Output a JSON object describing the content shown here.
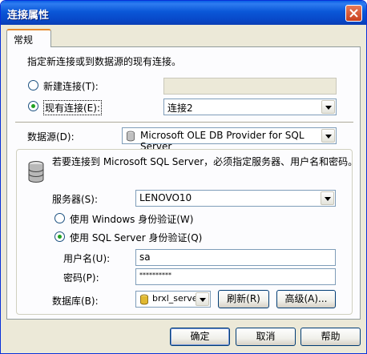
{
  "window": {
    "title": "连接属性"
  },
  "tabs": [
    {
      "label": "常规"
    }
  ],
  "general": {
    "instruction": "指定新连接或到数据源的现有连接。",
    "new_connection": {
      "label": "新建连接(T):",
      "value": ""
    },
    "existing_connection": {
      "label": "现有连接(E):",
      "value": "连接2"
    },
    "data_source": {
      "label": "数据源(D):",
      "value": "Microsoft OLE DB Provider for SQL Server"
    }
  },
  "sql_group": {
    "note": "若要连接到 Microsoft SQL Server，必须指定服务器、用户名和密码。",
    "server": {
      "label": "服务器(S):",
      "value": "LENOVO10"
    },
    "auth_windows": {
      "label": "使用 Windows 身份验证(W)"
    },
    "auth_sql": {
      "label": "使用 SQL Server 身份验证(Q)"
    },
    "username": {
      "label": "用户名(U):",
      "value": "sa"
    },
    "password": {
      "label": "密码(P):",
      "value": "**********"
    },
    "database": {
      "label": "数据库(B):",
      "value": "brxl_server"
    },
    "refresh_label": "刷新(R)",
    "advanced_label": "高级(A)..."
  },
  "footer": {
    "ok_label": "确定",
    "cancel_label": "取消",
    "help_label": "帮助"
  }
}
